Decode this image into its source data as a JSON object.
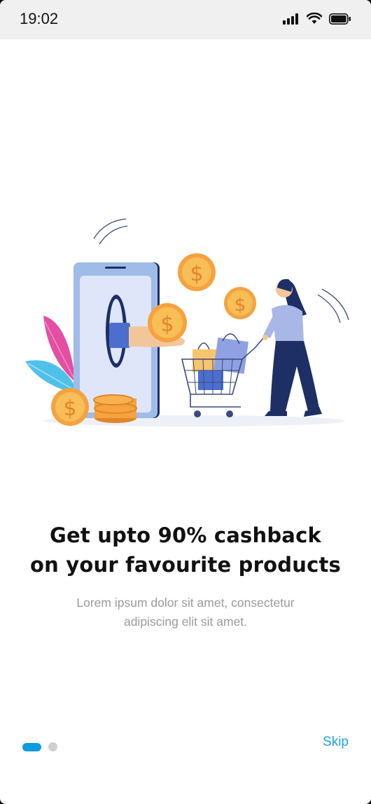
{
  "status_bar": {
    "time": "19:02"
  },
  "onboarding": {
    "title_line1": "Get upto 90% cashback",
    "title_line2": "on your favourite products",
    "subtitle_line1": "Lorem ipsum dolor sit amet, consectetur",
    "subtitle_line2": "adipiscing elit sit amet.",
    "skip_label": "Skip",
    "page_indicator": {
      "current": 1,
      "total": 2
    }
  },
  "icons": [
    "signal-icon",
    "wifi-icon",
    "battery-icon",
    "cashback-illustration"
  ],
  "colors": {
    "accent": "#0f9be0",
    "skip": "#1da1e8",
    "title": "#111111",
    "subtitle": "#9a9a9a"
  }
}
